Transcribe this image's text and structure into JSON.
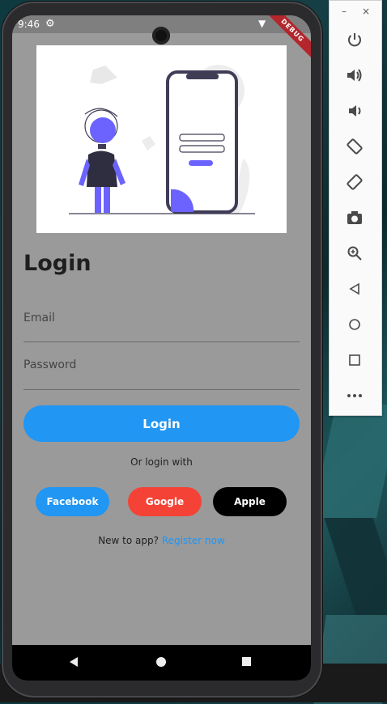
{
  "status_bar": {
    "time": "9:46",
    "settings_icon": "gear-icon",
    "wifi_icon": "wifi-icon",
    "battery_icon": "battery-icon",
    "debug_label": "DEBUG"
  },
  "illustration": {
    "description_icon": "login-illustration"
  },
  "login": {
    "title": "Login",
    "email_placeholder": "Email",
    "password_placeholder": "Password",
    "login_button": "Login",
    "or_text": "Or login with",
    "social": {
      "facebook": "Facebook",
      "google": "Google",
      "apple": "Apple"
    },
    "register_prompt": "New to app?",
    "register_link": "Register now"
  },
  "colors": {
    "primary": "#2196f3",
    "facebook": "#2196f3",
    "google": "#f44336",
    "apple": "#000000",
    "screen_bg": "#9a9a9a"
  },
  "nav_bar": {
    "back_icon": "back-triangle-icon",
    "home_icon": "home-circle-icon",
    "recents_icon": "recents-square-icon"
  },
  "emulator_toolbar": {
    "minimize": "–",
    "close": "×",
    "buttons": [
      {
        "name": "power-icon",
        "glyph": "⏻"
      },
      {
        "name": "volume-up-icon",
        "glyph": "🔊"
      },
      {
        "name": "volume-down-icon",
        "glyph": "🔉"
      },
      {
        "name": "rotate-left-icon",
        "glyph": "⟲"
      },
      {
        "name": "rotate-right-icon",
        "glyph": "⟳"
      },
      {
        "name": "camera-icon",
        "glyph": "📷"
      },
      {
        "name": "zoom-icon",
        "glyph": "🔍"
      },
      {
        "name": "back-icon",
        "glyph": "◁"
      },
      {
        "name": "home-icon",
        "glyph": "○"
      },
      {
        "name": "overview-icon",
        "glyph": "□"
      },
      {
        "name": "more-icon",
        "glyph": "•••"
      }
    ]
  }
}
